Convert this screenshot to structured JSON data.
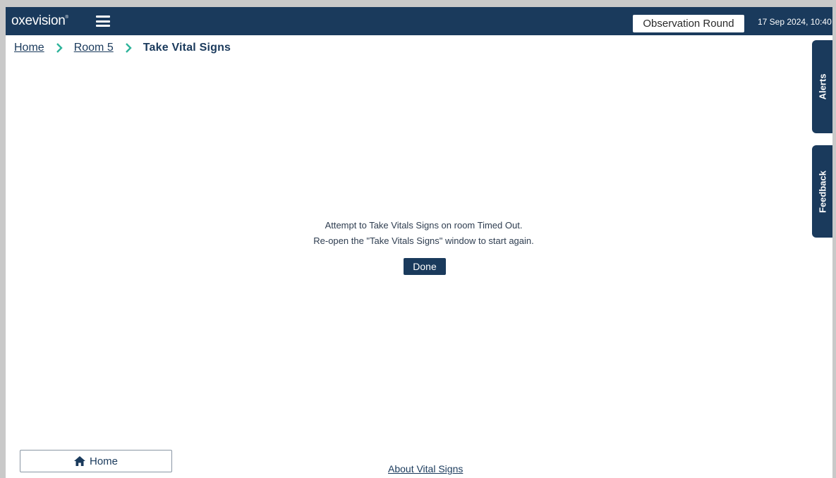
{
  "header": {
    "logo_text": "oxevision",
    "logo_mark": "®",
    "observation_round_label": "Observation Round",
    "datetime": "17 Sep 2024, 10:40"
  },
  "breadcrumb": {
    "home": "Home",
    "room": "Room 5",
    "current": "Take Vital Signs"
  },
  "side_tabs": {
    "alerts": "Alerts",
    "feedback": "Feedback"
  },
  "message": {
    "line1": "Attempt to Take Vitals Signs on room Timed Out.",
    "line2": "Re-open the \"Take Vitals Signs\" window to start again.",
    "done_label": "Done"
  },
  "footer": {
    "home_label": "Home",
    "about_link": "About Vital Signs"
  },
  "colors": {
    "brand_navy": "#1a3a5c",
    "chevron_green": "#2db39a"
  },
  "icons": {
    "menu": "hamburger-menu-icon",
    "chevron": "chevron-right-icon",
    "home": "home-icon"
  }
}
